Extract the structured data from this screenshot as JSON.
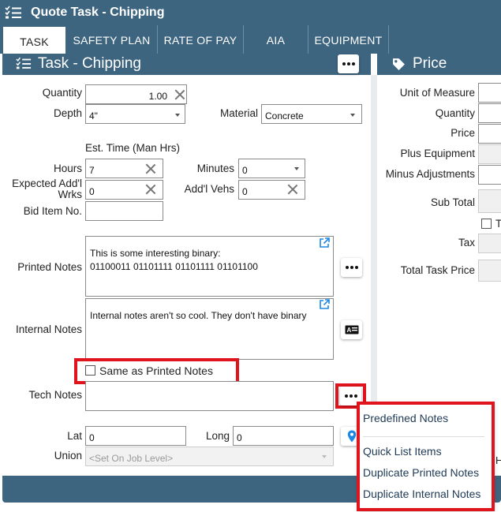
{
  "window": {
    "title": "Quote Task - Chipping"
  },
  "tabs": [
    {
      "label": "TASK",
      "active": true
    },
    {
      "label": "SAFETY PLAN",
      "active": false
    },
    {
      "label": "RATE OF PAY",
      "active": false
    },
    {
      "label": "AIA",
      "active": false
    },
    {
      "label": "EQUIPMENT",
      "active": false
    }
  ],
  "task_panel": {
    "title": "Task - Chipping",
    "quantity": {
      "label": "Quantity",
      "value": "1.00"
    },
    "depth": {
      "label": "Depth",
      "value": "4\""
    },
    "material": {
      "label": "Material",
      "value": "Concrete"
    },
    "est_time_heading": "Est. Time (Man Hrs)",
    "hours": {
      "label": "Hours",
      "value": "7"
    },
    "minutes": {
      "label": "Minutes",
      "value": "0"
    },
    "expected_addl_wrks": {
      "label_line1": "Expected Add'l",
      "label_line2": "Wrks",
      "value": "0"
    },
    "addl_vehs": {
      "label": "Add'l Vehs",
      "value": "0"
    },
    "bid_item_no": {
      "label": "Bid Item No.",
      "value": ""
    },
    "printed_notes": {
      "label": "Printed Notes",
      "line1": "This is some interesting binary:",
      "line2": "01100011 01101111 01101111 01101100"
    },
    "internal_notes": {
      "label": "Internal Notes",
      "text": "Internal notes aren't so cool. They don't have binary"
    },
    "same_as_printed": {
      "label": "Same as Printed Notes",
      "checked": false
    },
    "tech_notes": {
      "label": "Tech Notes",
      "value": ""
    },
    "lat": {
      "label": "Lat",
      "value": "0"
    },
    "long": {
      "label": "Long",
      "value": "0"
    },
    "union": {
      "label": "Union",
      "placeholder": "<Set On Job Level>"
    }
  },
  "price_panel": {
    "title": "Price",
    "unit_of_measure": "Unit of Measure",
    "quantity": "Quantity",
    "price": "Price",
    "plus_equipment": "Plus Equipment",
    "minus_adjustments": "Minus Adjustments",
    "sub_total": "Sub Total",
    "taxable_cut": "T",
    "tax": "Tax",
    "total_task_price": "Total Task Price",
    "cut_letter": "H"
  },
  "notes_menu": {
    "items": [
      "Predefined Notes",
      "Quick List Items",
      "Duplicate Printed Notes",
      "Duplicate Internal Notes"
    ]
  },
  "colors": {
    "header": "#3e6580",
    "highlight": "#e0141c",
    "menu_text": "#1f3a55",
    "location_pin": "#1e88e5"
  },
  "icons": [
    "list-check-icon",
    "tag-icon",
    "more-icon",
    "external-link-icon",
    "id-card-icon",
    "location-pin-icon",
    "close-icon",
    "chevron-down-icon"
  ]
}
